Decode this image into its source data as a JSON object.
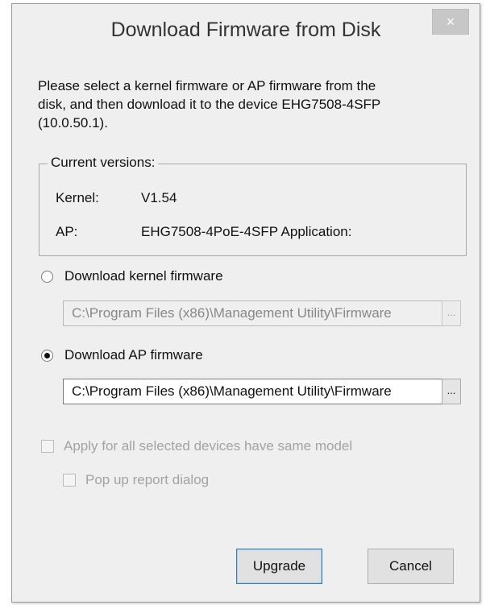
{
  "window": {
    "title": "Download Firmware from Disk",
    "close_glyph": "×"
  },
  "intro": {
    "line1": "Please select a kernel firmware or AP firmware from the",
    "line2": "disk, and then download it to the device EHG7508-4SFP",
    "line3": "(10.0.50.1)."
  },
  "versions": {
    "legend": "Current versions:",
    "kernel_label": "Kernel:",
    "kernel_value": "V1.54",
    "ap_label": "AP:",
    "ap_value": "EHG7508-4PoE-4SFP Application:"
  },
  "kernel_option": {
    "label": "Download kernel firmware",
    "selected": false,
    "path": "C:\\Program Files (x86)\\Management Utility\\Firmware",
    "browse_label": "..."
  },
  "ap_option": {
    "label": "Download AP firmware",
    "selected": true,
    "path": "C:\\Program Files (x86)\\Management Utility\\Firmware",
    "browse_label": "..."
  },
  "options": {
    "apply_all": "Apply for all selected devices have same model",
    "popup_report": "Pop up report dialog"
  },
  "buttons": {
    "upgrade": "Upgrade",
    "cancel": "Cancel"
  },
  "icons": {
    "close": "close-icon"
  }
}
